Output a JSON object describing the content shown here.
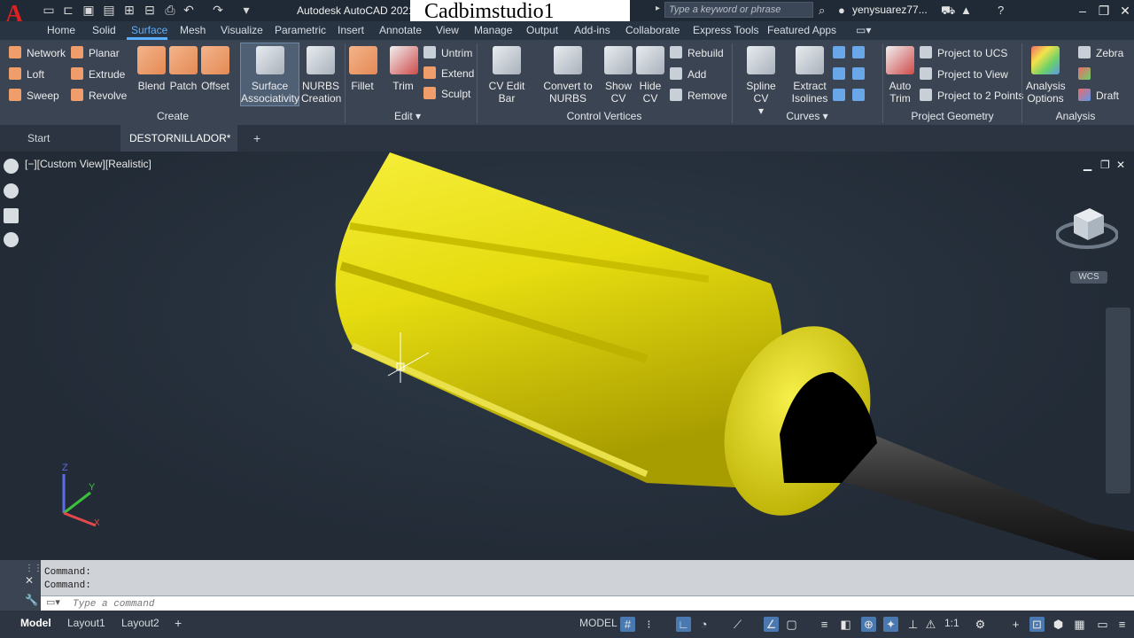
{
  "app": {
    "logo": "A",
    "title": "Autodesk AutoCAD 2021",
    "watermark": "Cadbimstudio1",
    "search_placeholder": "Type a keyword or phrase",
    "user": "yenysuarez77..."
  },
  "ribbon_tabs": [
    "Home",
    "Solid",
    "Surface",
    "Mesh",
    "Visualize",
    "Parametric",
    "Insert",
    "Annotate",
    "View",
    "Manage",
    "Output",
    "Add-ins",
    "Collaborate",
    "Express Tools",
    "Featured Apps"
  ],
  "active_tab": "Surface",
  "ribbon": {
    "create": {
      "title": "Create",
      "small": [
        "Network",
        "Loft",
        "Sweep",
        "Planar",
        "Extrude",
        "Revolve"
      ],
      "big": [
        {
          "line1": "Blend",
          "line2": ""
        },
        {
          "line1": "Patch",
          "line2": ""
        },
        {
          "line1": "Offset",
          "line2": ""
        },
        {
          "line1": "Surface",
          "line2": "Associativity"
        },
        {
          "line1": "NURBS",
          "line2": "Creation"
        }
      ]
    },
    "edit": {
      "title": "Edit",
      "big": [
        {
          "line1": "Fillet",
          "line2": ""
        },
        {
          "line1": "Trim",
          "line2": ""
        }
      ],
      "small": [
        "Untrim",
        "Extend",
        "Sculpt"
      ]
    },
    "control_vertices": {
      "title": "Control Vertices",
      "big": [
        {
          "line1": "CV Edit Bar",
          "line2": ""
        },
        {
          "line1": "Convert to",
          "line2": "NURBS"
        },
        {
          "line1": "Show",
          "line2": "CV"
        },
        {
          "line1": "Hide",
          "line2": "CV"
        }
      ],
      "small": [
        "Rebuild",
        "Add",
        "Remove"
      ]
    },
    "curves": {
      "title": "Curves",
      "big": [
        {
          "line1": "Spline CV",
          "line2": ""
        },
        {
          "line1": "Extract",
          "line2": "Isolines"
        }
      ]
    },
    "project_geometry": {
      "title": "Project Geometry",
      "big": [
        {
          "line1": "Auto",
          "line2": "Trim"
        }
      ],
      "small": [
        "Project to UCS",
        "Project to View",
        "Project to 2 Points"
      ]
    },
    "analysis": {
      "title": "Analysis",
      "big": [
        {
          "line1": "Analysis",
          "line2": "Options"
        }
      ],
      "small": [
        "Zebra",
        "",
        "Draft"
      ]
    }
  },
  "file_tabs": [
    "Start",
    "DESTORNILLADOR*"
  ],
  "viewport": {
    "label": "[−][Custom View][Realistic]",
    "wcs": "WCS",
    "axis_z": "Z",
    "axis_y": "Y",
    "axis_x": "X"
  },
  "command": {
    "history": [
      "Command:",
      "Command:"
    ],
    "placeholder": "Type a command"
  },
  "status": {
    "layout_tabs": [
      "Model",
      "Layout1",
      "Layout2"
    ],
    "model_label": "MODEL",
    "scale": "1:1"
  },
  "colors": {
    "handle_yellow": "#f2ea1a",
    "accent_blue": "#5ab0ff",
    "logo_red": "#e02020"
  }
}
